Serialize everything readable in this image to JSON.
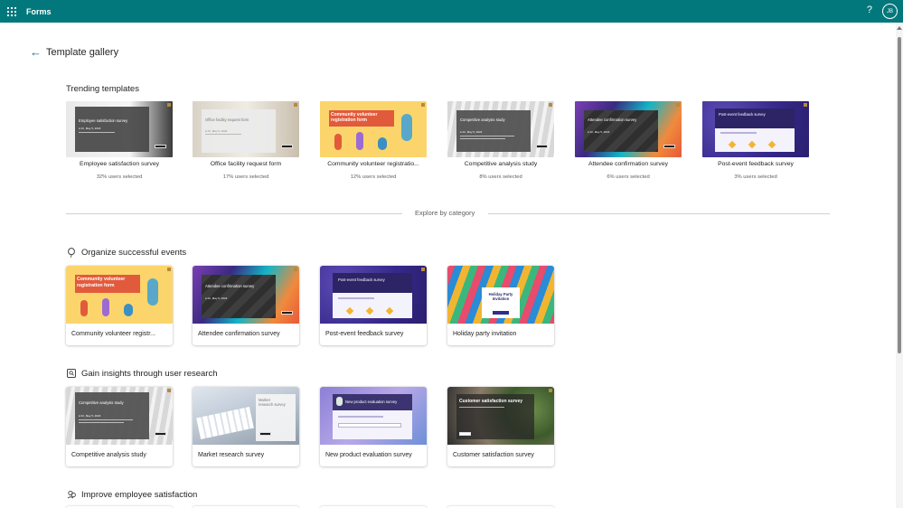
{
  "app": {
    "name": "Forms",
    "help_glyph": "?",
    "avatar_initials": "JB"
  },
  "page": {
    "back_label": "←",
    "title": "Template gallery"
  },
  "trending": {
    "title": "Trending templates",
    "cards": [
      {
        "name": "Employee satisfaction survey",
        "meta": "32% users selected",
        "thumb_title": "Employee satisfaction survey"
      },
      {
        "name": "Office facility request form",
        "meta": "17% users selected",
        "thumb_title": "Office facility request form"
      },
      {
        "name": "Community volunteer registratio...",
        "meta": "12% users selected",
        "thumb_title": "Community volunteer registration form"
      },
      {
        "name": "Competitive analysis study",
        "meta": "8% users selected",
        "thumb_title": "Competitive analysis study"
      },
      {
        "name": "Attendee confirmation survey",
        "meta": "6% users selected",
        "thumb_title": "Attendee confirmation survey"
      },
      {
        "name": "Post-event feedback survey",
        "meta": "3% users selected",
        "thumb_title": "Post-event feedback survey"
      }
    ]
  },
  "explore_label": "Explore by category",
  "categories": [
    {
      "title": "Organize successful events",
      "cards": [
        {
          "name": "Community volunteer registr...",
          "thumb_title": "Community volunteer registration form"
        },
        {
          "name": "Attendee confirmation survey",
          "thumb_title": "Attendee confirmation survey"
        },
        {
          "name": "Post-event feedback survey",
          "thumb_title": "Post-event feedback survey"
        },
        {
          "name": "Holiday party invitation",
          "thumb_title": "Holiday Party Invitation"
        }
      ]
    },
    {
      "title": "Gain insights through user research",
      "cards": [
        {
          "name": "Competitive analysis study",
          "thumb_title": "Competitive analysis study"
        },
        {
          "name": "Market research survey",
          "thumb_title": "Market research survey"
        },
        {
          "name": "New product evaluation survey",
          "thumb_title": "New product evaluation survey"
        },
        {
          "name": "Customer satisfaction survey",
          "thumb_title": "Customer satisfaction survey"
        }
      ]
    },
    {
      "title": "Improve employee satisfaction"
    }
  ],
  "thumb_common": {
    "date_line": "● Fri, May 5, 2023",
    "button_label": "Start now"
  },
  "colors": {
    "topbar": "#03787c",
    "accent": "#03787c"
  }
}
